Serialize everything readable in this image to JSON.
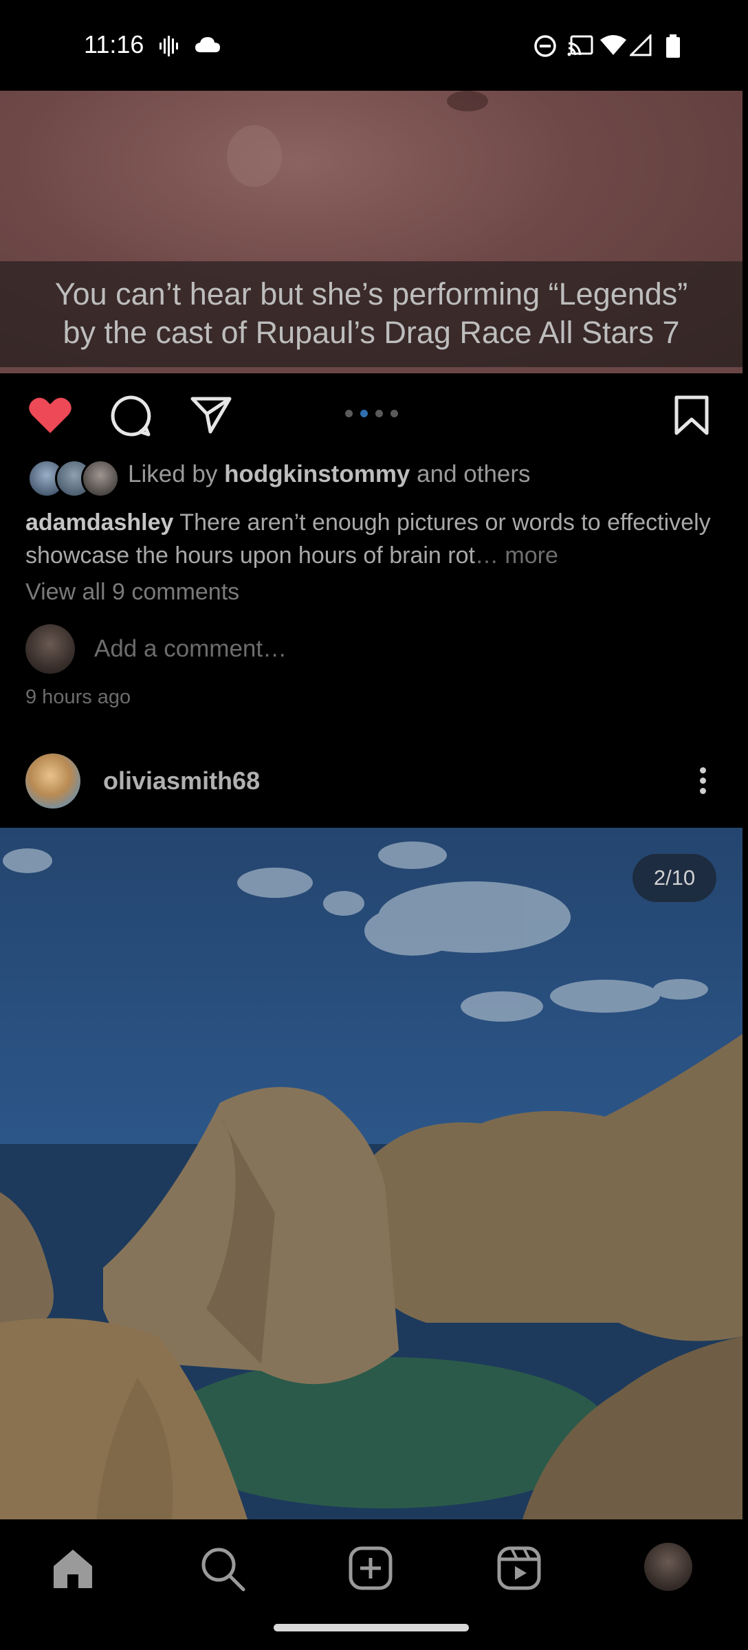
{
  "status_bar": {
    "time": "11:16",
    "left_icons": [
      "voicemail-wave-icon",
      "cloud-icon"
    ],
    "right_icons": [
      "do-not-disturb-icon",
      "cast-icon",
      "wifi-icon",
      "cellular-signal-icon",
      "battery-icon"
    ]
  },
  "post1": {
    "media_caption_line1": "You can’t hear but she’s performing “Legends”",
    "media_caption_line2": "by the cast of Rupaul’s Drag Race All Stars 7",
    "liked": true,
    "carousel": {
      "count": 4,
      "active_index": 1
    },
    "likes": {
      "prefix": "Liked by",
      "user": "hodgkinstommy",
      "suffix": "and others"
    },
    "caption": {
      "username": "adamdashley",
      "text": "There aren’t enough pictures or words to effectively showcase the hours upon hours of brain rot",
      "ellipsis": "…",
      "more": "more"
    },
    "view_comments": "View all 9 comments",
    "add_comment_placeholder": "Add a comment…",
    "time_ago": "9 hours ago"
  },
  "post2": {
    "username": "oliviasmith68",
    "counter": "2/10"
  },
  "bottom_nav": {
    "items": [
      "home-icon",
      "search-icon",
      "create-post-icon",
      "reels-icon",
      "profile-avatar"
    ]
  },
  "colors": {
    "like_red": "#ed4956",
    "carousel_active": "#2f6fb0",
    "background": "#000000"
  }
}
